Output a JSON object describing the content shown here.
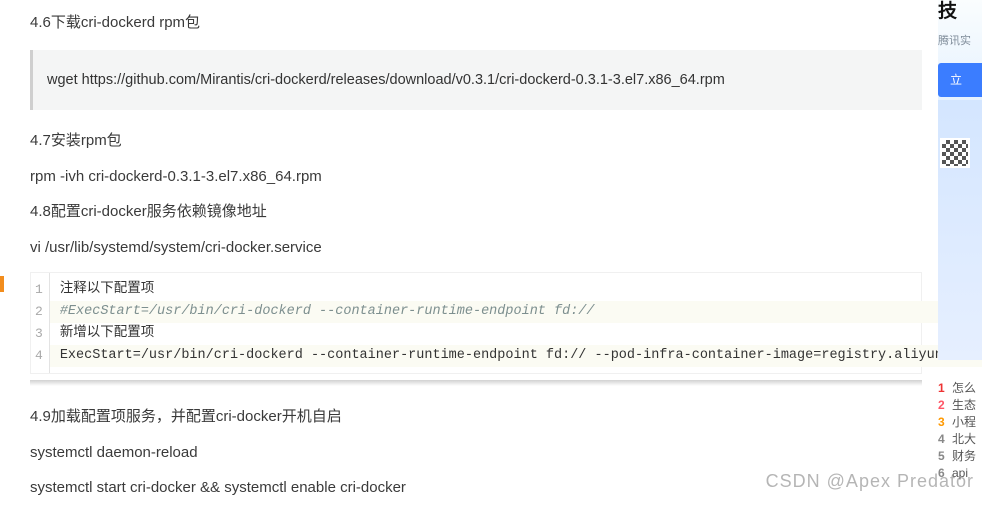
{
  "article": {
    "p_46": "4.6下载cri-dockerd rpm包",
    "quote_cmd": "wget https://github.com/Mirantis/cri-dockerd/releases/download/v0.3.1/cri-dockerd-0.3.1-3.el7.x86_64.rpm",
    "p_47": "4.7安装rpm包",
    "cmd_47": "rpm -ivh cri-dockerd-0.3.1-3.el7.x86_64.rpm",
    "p_48": "4.8配置cri-docker服务依赖镜像地址",
    "cmd_48": "vi /usr/lib/systemd/system/cri-docker.service",
    "code_lines": [
      {
        "n": "1",
        "text": "注释以下配置项",
        "cls": ""
      },
      {
        "n": "2",
        "text": "#ExecStart=/usr/bin/cri-dockerd --container-runtime-endpoint fd://",
        "cls": "code-comment code-highlight"
      },
      {
        "n": "3",
        "text": "新增以下配置项",
        "cls": ""
      },
      {
        "n": "4",
        "text": "ExecStart=/usr/bin/cri-dockerd --container-runtime-endpoint fd:// --pod-infra-container-image=registry.aliyuncs.com/go",
        "cls": "code-highlight"
      }
    ],
    "p_49": "4.9加载配置项服务，并配置cri-docker开机自启",
    "cmd_49a": "systemctl daemon-reload",
    "cmd_49b": "systemctl start cri-docker && systemctl enable cri-docker"
  },
  "rail": {
    "ad_title": "技",
    "ad_sub": "腾讯实",
    "ad_btn": "立",
    "hotlist": [
      {
        "rank": "1",
        "text": "怎么"
      },
      {
        "rank": "2",
        "text": "生态"
      },
      {
        "rank": "3",
        "text": "小程"
      },
      {
        "rank": "4",
        "text": "北大"
      },
      {
        "rank": "5",
        "text": "财务"
      },
      {
        "rank": "6",
        "text": "api"
      }
    ]
  },
  "watermark": "CSDN @Apex   Predator"
}
